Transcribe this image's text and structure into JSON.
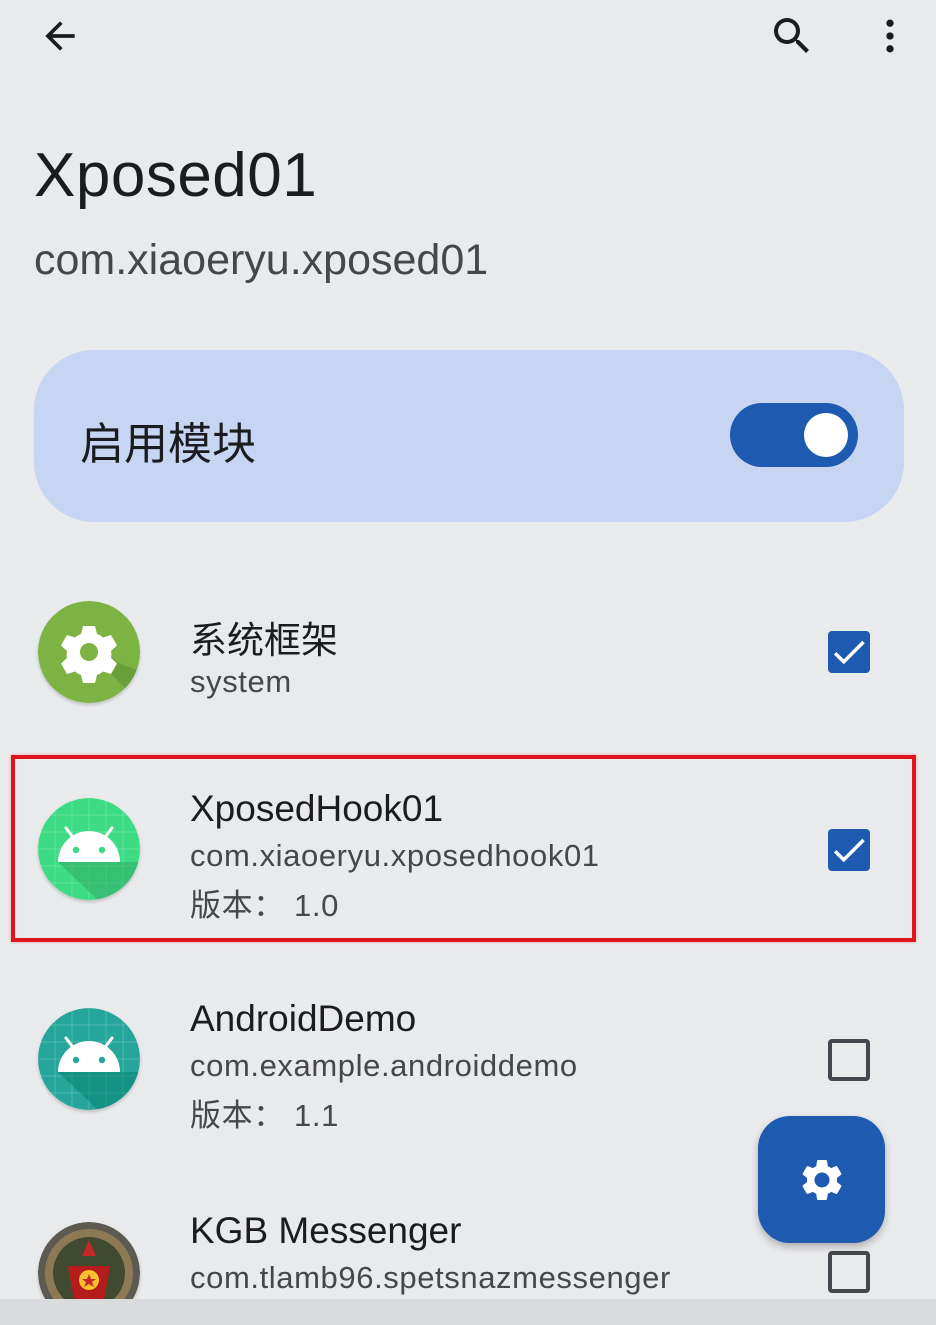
{
  "topbar": {
    "back_icon": "arrow-left-icon",
    "search_icon": "search-icon",
    "more_icon": "more-vert-icon"
  },
  "header": {
    "title": "Xposed01",
    "package": "com.xiaoeryu.xposed01"
  },
  "enable": {
    "label": "启用模块",
    "switch_on": true
  },
  "apps": [
    {
      "name": "系统框架",
      "package": "system",
      "version": "",
      "checked": true,
      "icon": "android-system-gear-icon"
    },
    {
      "name": "XposedHook01",
      "package": "com.xiaoeryu.xposedhook01",
      "version": "版本：  1.0",
      "checked": true,
      "icon": "android-robot-icon"
    },
    {
      "name": "AndroidDemo",
      "package": "com.example.androiddemo",
      "version": "版本：  1.1",
      "checked": false,
      "icon": "android-robot-icon"
    },
    {
      "name": "KGB Messenger",
      "package": "com.tlamb96.spetsnazmessenger",
      "version": "",
      "checked": false,
      "icon": "kgb-emblem-icon"
    }
  ],
  "fab": {
    "icon": "gear-icon"
  },
  "colors": {
    "background": "#e9eaec",
    "accent": "#1d5ab0",
    "card": "#c8d5f2",
    "highlight": "#e0141b"
  }
}
